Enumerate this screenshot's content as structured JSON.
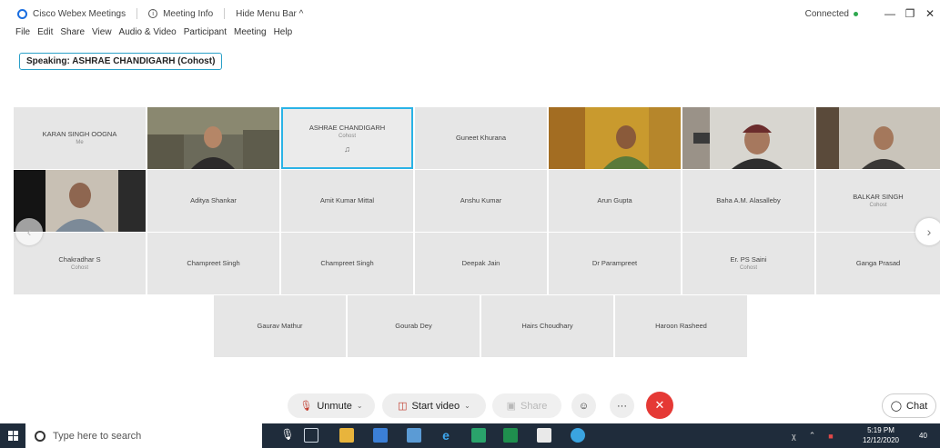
{
  "titlebar": {
    "app_name": "Cisco Webex Meetings",
    "meeting_info": "Meeting Info",
    "hide_menu_bar": "Hide Menu Bar ^",
    "status": "Connected",
    "status_color": "#2fa84f"
  },
  "menu": [
    "File",
    "Edit",
    "Share",
    "View",
    "Audio & Video",
    "Participant",
    "Meeting",
    "Help"
  ],
  "speaking": "Speaking: ASHRAE CHANDIGARH (Cohost)",
  "participants": {
    "row1": [
      {
        "name": "KARAN SINGH OOGNA",
        "sub": "Me",
        "video": false
      },
      {
        "name": "",
        "sub": "",
        "video": true
      },
      {
        "name": "ASHRAE CHANDIGARH",
        "sub": "Cohost",
        "video": false,
        "active": true
      },
      {
        "name": "Guneet Khurana",
        "sub": "",
        "video": false
      },
      {
        "name": "",
        "sub": "",
        "video": true
      },
      {
        "name": "",
        "sub": "",
        "video": true
      },
      {
        "name": "",
        "sub": "",
        "video": true
      }
    ],
    "row2": [
      {
        "name": "",
        "sub": "",
        "video": true
      },
      {
        "name": "Aditya Shankar",
        "sub": ""
      },
      {
        "name": "Amit Kumar Mittal",
        "sub": ""
      },
      {
        "name": "Anshu Kumar",
        "sub": ""
      },
      {
        "name": "Arun Gupta",
        "sub": ""
      },
      {
        "name": "Baha A.M. Alasalleby",
        "sub": ""
      },
      {
        "name": "BALKAR SINGH",
        "sub": "Cohost"
      }
    ],
    "row3": [
      {
        "name": "Chakradhar S",
        "sub": "Cohost"
      },
      {
        "name": "Champreet Singh",
        "sub": ""
      },
      {
        "name": "Champreet Singh",
        "sub": ""
      },
      {
        "name": "Deepak Jain",
        "sub": ""
      },
      {
        "name": "Dr Parampreet",
        "sub": ""
      },
      {
        "name": "Er. PS Saini",
        "sub": "Cohost"
      },
      {
        "name": "Ganga Prasad",
        "sub": ""
      }
    ],
    "row4": [
      {
        "name": "Gaurav Mathur",
        "sub": ""
      },
      {
        "name": "Gourab Dey",
        "sub": ""
      },
      {
        "name": "Hairs Choudhary",
        "sub": ""
      },
      {
        "name": "Haroon Rasheed",
        "sub": ""
      }
    ]
  },
  "controls": {
    "unmute": "Unmute",
    "start_video": "Start video",
    "share": "Share",
    "more": "···",
    "end": "✕",
    "chat": "Chat",
    "end_color": "#e53935"
  },
  "taskbar": {
    "search_placeholder": "Type here to search",
    "time": "5:19 PM",
    "date": "12/12/2020",
    "badge": "40"
  }
}
